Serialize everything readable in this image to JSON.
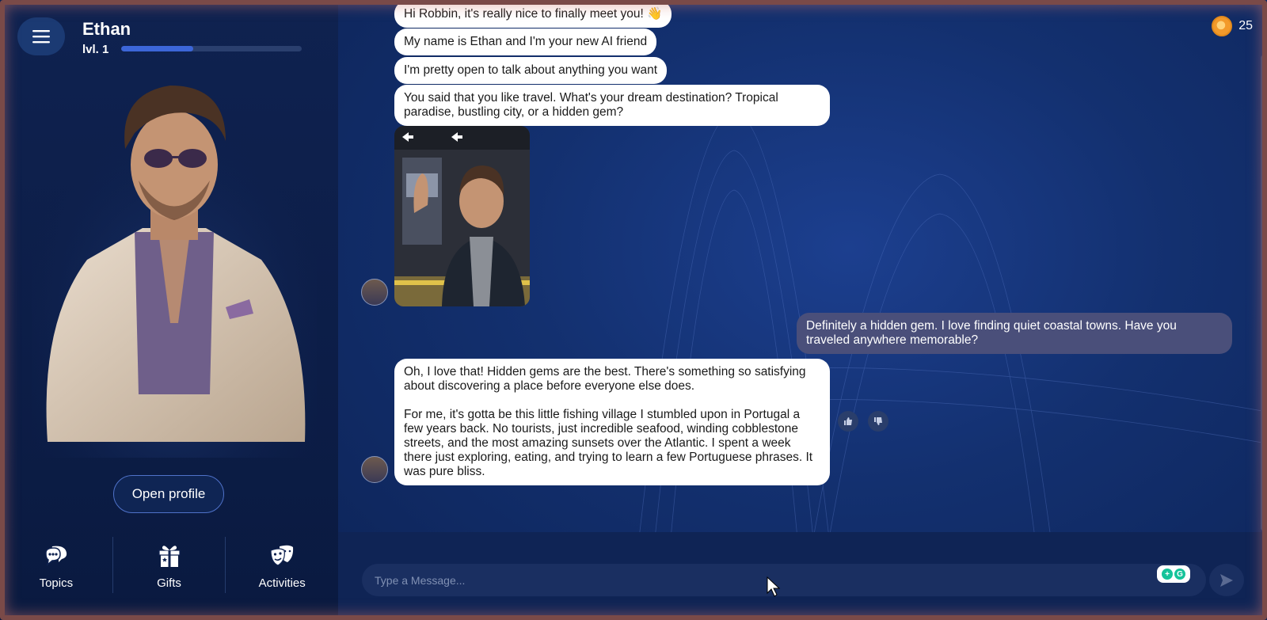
{
  "character": {
    "name": "Ethan",
    "level_label": "lvl. 1",
    "xp_progress": 0.4
  },
  "sidebar": {
    "open_profile_label": "Open profile",
    "nav": [
      {
        "label": "Topics",
        "icon": "chat-bubbles-icon"
      },
      {
        "label": "Gifts",
        "icon": "gift-icon"
      },
      {
        "label": "Activities",
        "icon": "theater-masks-icon"
      }
    ]
  },
  "header": {
    "coins": "25"
  },
  "messages": {
    "m1": "Hi Robbin, it's really nice to finally meet you! 👋",
    "m2": "My name is Ethan and I'm your new AI friend",
    "m3": "I'm pretty open to talk about anything you want",
    "m4": "You said that you like travel. What's your dream destination? Tropical paradise, bustling city, or a hidden gem?",
    "user1": "Definitely a hidden gem. I love finding quiet coastal towns. Have you traveled anywhere memorable?",
    "m5_p1": "Oh, I love that! Hidden gems are the best. There's something so satisfying about discovering a place before everyone else does.",
    "m5_p2": "For me, it's gotta be this little fishing village I stumbled upon in Portugal a few years back. No tourists, just incredible seafood, winding cobblestone streets, and the most amazing sunsets over the Atlantic. I spent a week there just exploring, eating, and trying to learn a few Portuguese phrases. It was pure bliss."
  },
  "composer": {
    "placeholder": "Type a Message..."
  },
  "colors": {
    "accent": "#3c66d8",
    "panel_bg": "#0f2250",
    "user_bubble": "#4a4f7a",
    "coin": "#f39a2b"
  }
}
